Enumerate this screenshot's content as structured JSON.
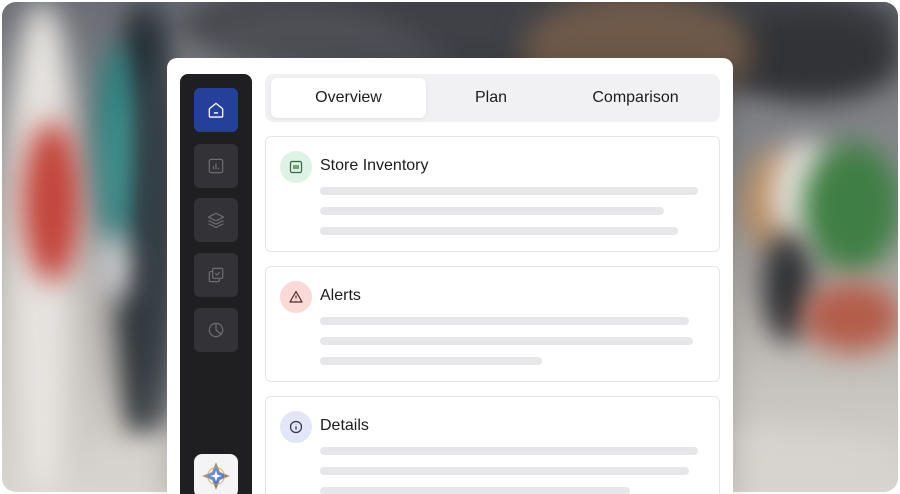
{
  "tabs": [
    {
      "label": "Overview",
      "active": true
    },
    {
      "label": "Plan",
      "active": false
    },
    {
      "label": "Comparison",
      "active": false
    }
  ],
  "sidebar": {
    "items": [
      {
        "icon": "home-icon",
        "active": true
      },
      {
        "icon": "bar-chart-icon",
        "active": false
      },
      {
        "icon": "layers-icon",
        "active": false
      },
      {
        "icon": "checklist-icon",
        "active": false
      },
      {
        "icon": "pie-chart-icon",
        "active": false
      }
    ],
    "logo_icon": "sparkle-logo-icon"
  },
  "cards": [
    {
      "title": "Store Inventory",
      "icon": "inventory-icon",
      "accent": "#dff3e4"
    },
    {
      "title": "Alerts",
      "icon": "warning-icon",
      "accent": "#fbd9d6"
    },
    {
      "title": "Details",
      "icon": "info-icon",
      "accent": "#e3e6f7"
    }
  ],
  "colors": {
    "sidebar_bg": "#1f1f22",
    "active_nav": "#24409a",
    "skeleton": "#e7e7ea"
  }
}
